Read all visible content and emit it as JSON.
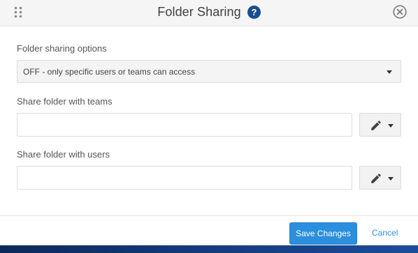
{
  "dialog": {
    "title": "Folder Sharing",
    "accent_color": "#2b8fde",
    "help_icon_color": "#1a4d8f"
  },
  "icons": {
    "drag": "drag-dots-icon",
    "help": "question-circle-icon",
    "close": "close-circle-icon",
    "edit": "pencil-icon",
    "dropdown": "caret-down-icon"
  },
  "fields": {
    "options_label": "Folder sharing options",
    "options_value": "OFF - only specific users or teams can access",
    "teams_label": "Share folder with teams",
    "teams_value": "",
    "users_label": "Share folder with users",
    "users_value": ""
  },
  "footer": {
    "save_label": "Save Changes",
    "cancel_label": "Cancel"
  }
}
